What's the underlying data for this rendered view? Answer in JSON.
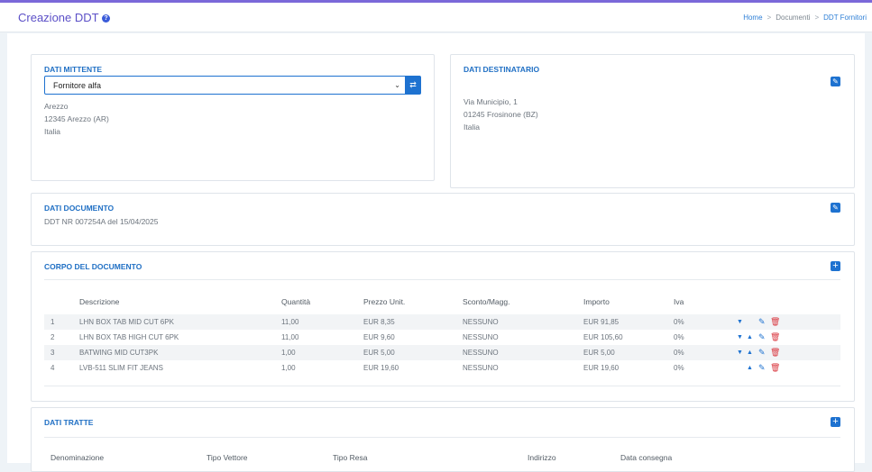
{
  "header": {
    "title": "Creazione DDT",
    "help_icon": "?",
    "breadcrumb": [
      "Home",
      "Documenti",
      "DDT Fornitori"
    ]
  },
  "mittente": {
    "title": "DATI MITTENTE",
    "selected": "Fornitore alfa",
    "address": [
      "Arezzo",
      "12345 Arezzo (AR)",
      "Italia"
    ]
  },
  "destinatario": {
    "title": "DATI DESTINATARIO",
    "address": [
      "Via Municipio, 1",
      "01245 Frosinone (BZ)",
      "Italia"
    ]
  },
  "documento": {
    "title": "DATI DOCUMENTO",
    "text": "DDT NR 007254A del 15/04/2025"
  },
  "corpo": {
    "title": "CORPO DEL DOCUMENTO",
    "columns": [
      "Descrizione",
      "Quantità",
      "Prezzo Unit.",
      "Sconto/Magg.",
      "Importo",
      "Iva"
    ],
    "rows": [
      {
        "n": "1",
        "desc": "LHN BOX TAB MID CUT 6PK",
        "qty": "11,00",
        "price": "EUR 8,35",
        "sconto": "NESSUNO",
        "importo": "EUR 91,85",
        "iva": "0%",
        "down": true,
        "up": false
      },
      {
        "n": "2",
        "desc": "LHN BOX TAB HIGH CUT 6PK",
        "qty": "11,00",
        "price": "EUR 9,60",
        "sconto": "NESSUNO",
        "importo": "EUR 105,60",
        "iva": "0%",
        "down": true,
        "up": true
      },
      {
        "n": "3",
        "desc": "BATWING MID CUT3PK",
        "qty": "1,00",
        "price": "EUR 5,00",
        "sconto": "NESSUNO",
        "importo": "EUR 5,00",
        "iva": "0%",
        "down": true,
        "up": true
      },
      {
        "n": "4",
        "desc": "LVB-511 SLIM FIT JEANS",
        "qty": "1,00",
        "price": "EUR 19,60",
        "sconto": "NESSUNO",
        "importo": "EUR 19,60",
        "iva": "0%",
        "down": false,
        "up": true
      }
    ]
  },
  "tratte": {
    "title": "DATI TRATTE",
    "columns": [
      "Denominazione",
      "Tipo Vettore",
      "Tipo Resa",
      "Indirizzo",
      "Data consegna"
    ]
  },
  "icons": {
    "edit": "edit-icon",
    "add": "plus-icon",
    "down": "arrow-down-icon",
    "up": "arrow-up-icon",
    "row_edit": "pencil-icon",
    "delete": "trash-icon",
    "shuffle": "shuffle-icon"
  },
  "colors": {
    "accent": "#7b68d9",
    "title": "#5b4fc7",
    "primary": "#1e72d0",
    "danger": "#d9363e"
  }
}
